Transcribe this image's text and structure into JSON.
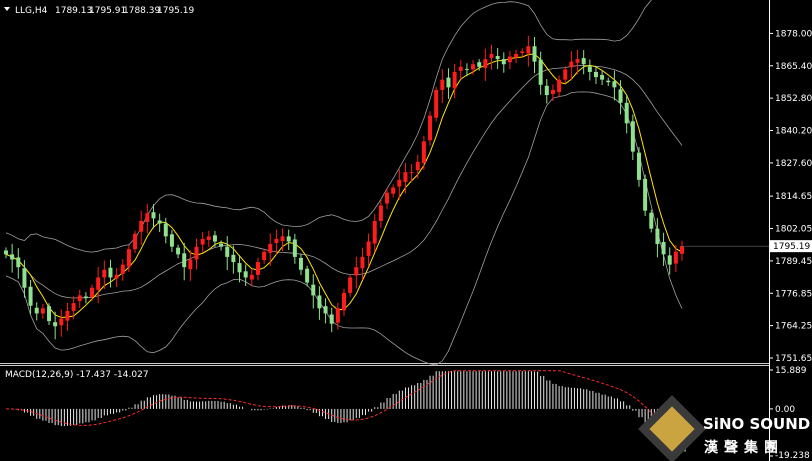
{
  "header": {
    "symbol": "LLG,H4",
    "open": "1789.13",
    "high": "1795.91",
    "low": "1788.39",
    "close": "1795.19"
  },
  "macd_label": "MACD(12,26,9) -17.437 -14.027",
  "logo": {
    "en": "SiNO SOUND",
    "cn": "漢聲集團"
  },
  "colors": {
    "background": "#000000",
    "bull": "#ff1c1c",
    "bear": "#8fe08f",
    "ma": "#ffe500",
    "bands": "#a0a0a0",
    "macd_hist": "#e8e8e8",
    "macd_signal": "#ff2b2b",
    "axis": "#ffffff"
  },
  "chart_data": [
    {
      "type": "candlestick",
      "symbol": "LLG",
      "timeframe": "H4",
      "ylim": [
        1751.65,
        1884.0
      ],
      "y_ticks": [
        "1878.00",
        "1865.40",
        "1852.80",
        "1840.20",
        "1827.60",
        "1814.65",
        "1802.05",
        "1789.45",
        "1776.85",
        "1764.25",
        "1751.65"
      ],
      "current_price": "1795.19",
      "indicators": [
        "Bollinger Bands",
        "Moving Average"
      ],
      "closes": [
        1792,
        1790,
        1787,
        1779,
        1772,
        1769,
        1771,
        1766,
        1764,
        1767,
        1770,
        1773,
        1776,
        1775,
        1779,
        1783,
        1786,
        1783,
        1784,
        1788,
        1794,
        1800,
        1805,
        1808,
        1806,
        1804,
        1799,
        1795,
        1792,
        1787,
        1790,
        1795,
        1798,
        1799,
        1797,
        1795,
        1791,
        1789,
        1785,
        1783,
        1784,
        1789,
        1793,
        1796,
        1798,
        1799,
        1797,
        1791,
        1786,
        1781,
        1776,
        1771,
        1769,
        1765,
        1771,
        1777,
        1783,
        1787,
        1791,
        1797,
        1805,
        1811,
        1816,
        1818,
        1821,
        1824,
        1824,
        1828,
        1836,
        1846,
        1856,
        1860,
        1857,
        1863,
        1865,
        1864,
        1866,
        1865,
        1868,
        1870,
        1868,
        1866,
        1869,
        1870,
        1871,
        1873,
        1867,
        1858,
        1854,
        1856,
        1860,
        1864,
        1867,
        1868,
        1866,
        1863,
        1861,
        1860,
        1859,
        1857,
        1851,
        1843,
        1832,
        1821,
        1809,
        1802,
        1796,
        1792,
        1788,
        1793,
        1795.19
      ]
    },
    {
      "type": "bar",
      "indicator": "MACD(12,26,9)",
      "macd": -17.437,
      "signal": -14.027,
      "ylim": [
        -19.238,
        15.889
      ],
      "y_ticks": [
        "15.889",
        "0.00",
        "-19.238"
      ]
    }
  ]
}
